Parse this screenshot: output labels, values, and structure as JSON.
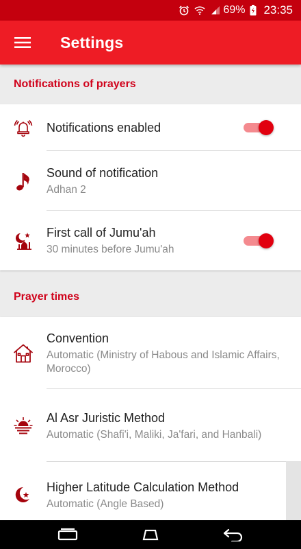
{
  "status_bar": {
    "battery_percent": "69%",
    "time": "23:35",
    "icons": [
      "alarm-icon",
      "wifi-icon",
      "signal-icon",
      "battery-charging-icon"
    ]
  },
  "app_bar": {
    "title": "Settings",
    "menu_icon": "hamburger-menu-icon"
  },
  "sections": [
    {
      "header": "Notifications of prayers",
      "items": [
        {
          "title": "Notifications enabled",
          "summary": "",
          "icon": "alarm-bell-icon",
          "switch_on": true
        },
        {
          "title": "Sound of notification",
          "summary": "Adhan 2",
          "icon": "music-note-icon"
        },
        {
          "title": "First call of Jumu'ah",
          "summary": "30 minutes before Jumu'ah",
          "icon": "mosque-crescent-icon",
          "switch_on": true
        }
      ]
    },
    {
      "header": "Prayer times",
      "items": [
        {
          "title": "Convention",
          "summary": "Automatic (Ministry of Habous and Islamic Affairs, Morocco)",
          "icon": "house-icon"
        },
        {
          "title": "Al Asr Juristic Method",
          "summary": "Automatic (Shafi'i, Maliki, Ja'fari, and Hanbali)",
          "icon": "sunset-icon"
        },
        {
          "title": "Higher Latitude Calculation Method",
          "summary": "Automatic (Angle Based)",
          "icon": "crescent-star-icon"
        }
      ]
    }
  ],
  "colors": {
    "status_bar": "#c4000e",
    "app_bar": "#ee1c25",
    "accent": "#d0021b",
    "switch_thumb": "#e1000f",
    "switch_track": "#f48a8f",
    "icon": "#a5040d"
  },
  "nav_bar": {
    "icons": [
      "recent-apps-icon",
      "home-icon",
      "back-icon"
    ]
  }
}
